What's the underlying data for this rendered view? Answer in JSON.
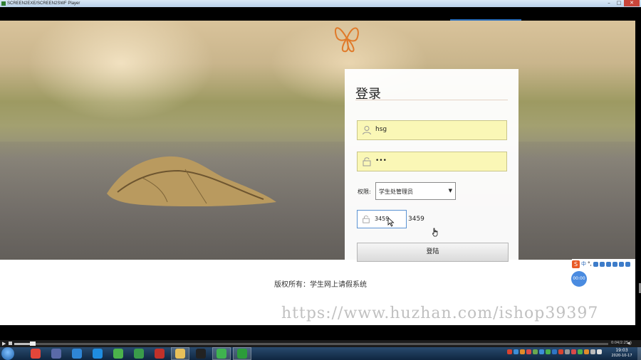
{
  "window": {
    "title": "SCREEN2EXE/SCREEN2SWF Player",
    "minimize": "–",
    "maximize": "□",
    "close": "✕"
  },
  "login": {
    "title": "登录",
    "username_value": "hsg",
    "password_value": "•••",
    "role_label": "权限:",
    "role_selected": "学生处管理员",
    "role_arrow": "▼",
    "captcha_input_value": "3459",
    "captcha_code": "3459",
    "login_button": "登陆"
  },
  "footer": {
    "copyright": "版权所有：学生网上请假系统"
  },
  "watermark": "https://www.huzhan.com/ishop39397",
  "ime": {
    "logo": "S",
    "mode": "中",
    "punct": "°,"
  },
  "overlay_badge": "00:00",
  "player": {
    "play_icon": "▶",
    "time": "0:04/2:25",
    "volume_icon": "◀)"
  },
  "taskbar": {
    "clock_time": "19:03",
    "clock_date": "2020-10-17",
    "apps": [
      {
        "name": "chrome",
        "color": "#e2463a"
      },
      {
        "name": "media-player",
        "color": "#5a6aa8"
      },
      {
        "name": "cloud",
        "color": "#2f86d6"
      },
      {
        "name": "browser",
        "color": "#1f8de0"
      },
      {
        "name": "green-app",
        "color": "#4bb24b"
      },
      {
        "name": "chart-app",
        "color": "#3a9c4a"
      },
      {
        "name": "flash",
        "color": "#c0312a"
      },
      {
        "name": "folder",
        "color": "#e8c05a"
      },
      {
        "name": "qq",
        "color": "#222222"
      },
      {
        "name": "wechat",
        "color": "#3fb34f"
      },
      {
        "name": "screen2exe",
        "color": "#2c9c3a"
      }
    ]
  },
  "colors": {
    "input_bg": "#faf7b6",
    "captcha_border": "#5b93d3",
    "taskbar": "#1c3a5c"
  }
}
